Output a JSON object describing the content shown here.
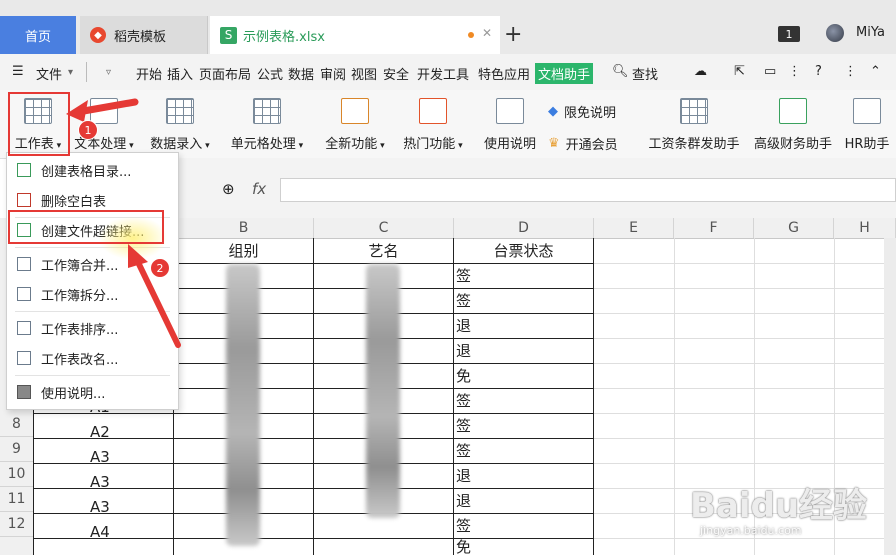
{
  "tabs": {
    "home": "首页",
    "template": "稻壳模板",
    "file": "示例表格.xlsx",
    "add": "+",
    "badge": "1",
    "user": "MiYa"
  },
  "menu": {
    "file": "文件",
    "items": [
      "开始",
      "插入",
      "页面布局",
      "公式",
      "数据",
      "审阅",
      "视图",
      "安全",
      "开发工具",
      "特色应用",
      "文档助手"
    ],
    "find": "查找"
  },
  "ribbon": {
    "sheet": "工作表",
    "text": "文本处理",
    "data_entry": "数据录入",
    "cell": "单元格处理",
    "new": "全新功能",
    "hot": "热门功能",
    "guide": "使用说明",
    "free": "限免说明",
    "vip": "开通会员",
    "salary": "工资条群发助手",
    "finance": "高级财务助手",
    "hr": "HR助手"
  },
  "formula": {
    "fx": "fx"
  },
  "dropdown": {
    "items": [
      "创建表格目录...",
      "删除空白表",
      "创建文件超链接...",
      "工作簿合并...",
      "工作簿拆分...",
      "工作表排序...",
      "工作表改名...",
      "使用说明..."
    ]
  },
  "sheet": {
    "columns": [
      "B",
      "C",
      "D",
      "E",
      "F",
      "G",
      "H"
    ],
    "header": {
      "b": "组别",
      "c": "艺名",
      "d": "台票状态"
    },
    "row_numbers": [
      "8",
      "9",
      "10",
      "11",
      "12"
    ],
    "col_a": [
      "A1",
      "A2",
      "A3",
      "A3",
      "A3",
      "A4"
    ],
    "col_d": [
      "签",
      "签",
      "退",
      "退",
      "免",
      "签",
      "签",
      "签",
      "退",
      "退",
      "签",
      "免"
    ]
  },
  "annotations": {
    "step1": "1",
    "step2": "2"
  },
  "watermark": {
    "brand": "Baidu经验",
    "url": "jingyan.baidu.com"
  },
  "colors": {
    "accent_green": "#2bb56b",
    "tab_blue": "#4a7fe0",
    "annotation_red": "#e53935"
  }
}
